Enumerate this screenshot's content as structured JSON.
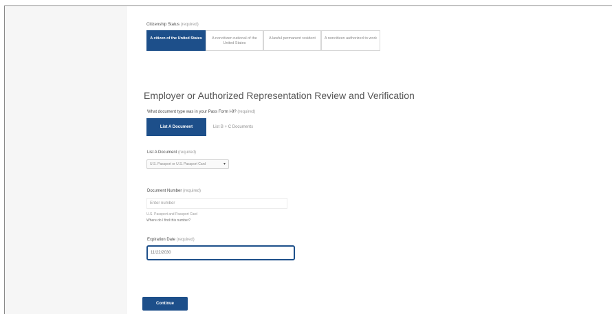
{
  "citizenship": {
    "label": "Citizenship Status",
    "hint": "(required)",
    "options": [
      {
        "label": "A citizen of the United States",
        "active": true
      },
      {
        "label": "A noncitizen national of the United States",
        "active": false
      },
      {
        "label": "A lawful permanent resident",
        "active": false
      },
      {
        "label": "A noncitizen authorized to work",
        "active": false
      }
    ]
  },
  "section": {
    "heading": "Employer or Authorized Representation Review and Verification"
  },
  "documents": {
    "question": "What document type was in your Pass Form I-9?",
    "hint": "(required)",
    "options": [
      {
        "label": "List A Document",
        "active": true
      },
      {
        "label": "List B + C Documents",
        "active": false
      }
    ]
  },
  "list_a": {
    "label": "List A Document",
    "hint": "(required)",
    "selected": "U.S. Passport or U.S. Passport Card"
  },
  "document_number": {
    "label": "Document Number",
    "hint": "(required)",
    "placeholder": "Enter number",
    "helper": "U.S. Passport and Passport Card",
    "helper_link": "Where do I find this number?"
  },
  "expiration": {
    "label": "Expiration Date",
    "hint": "(required)",
    "value": "11/22/2030"
  },
  "actions": {
    "continue_label": "Continue"
  }
}
